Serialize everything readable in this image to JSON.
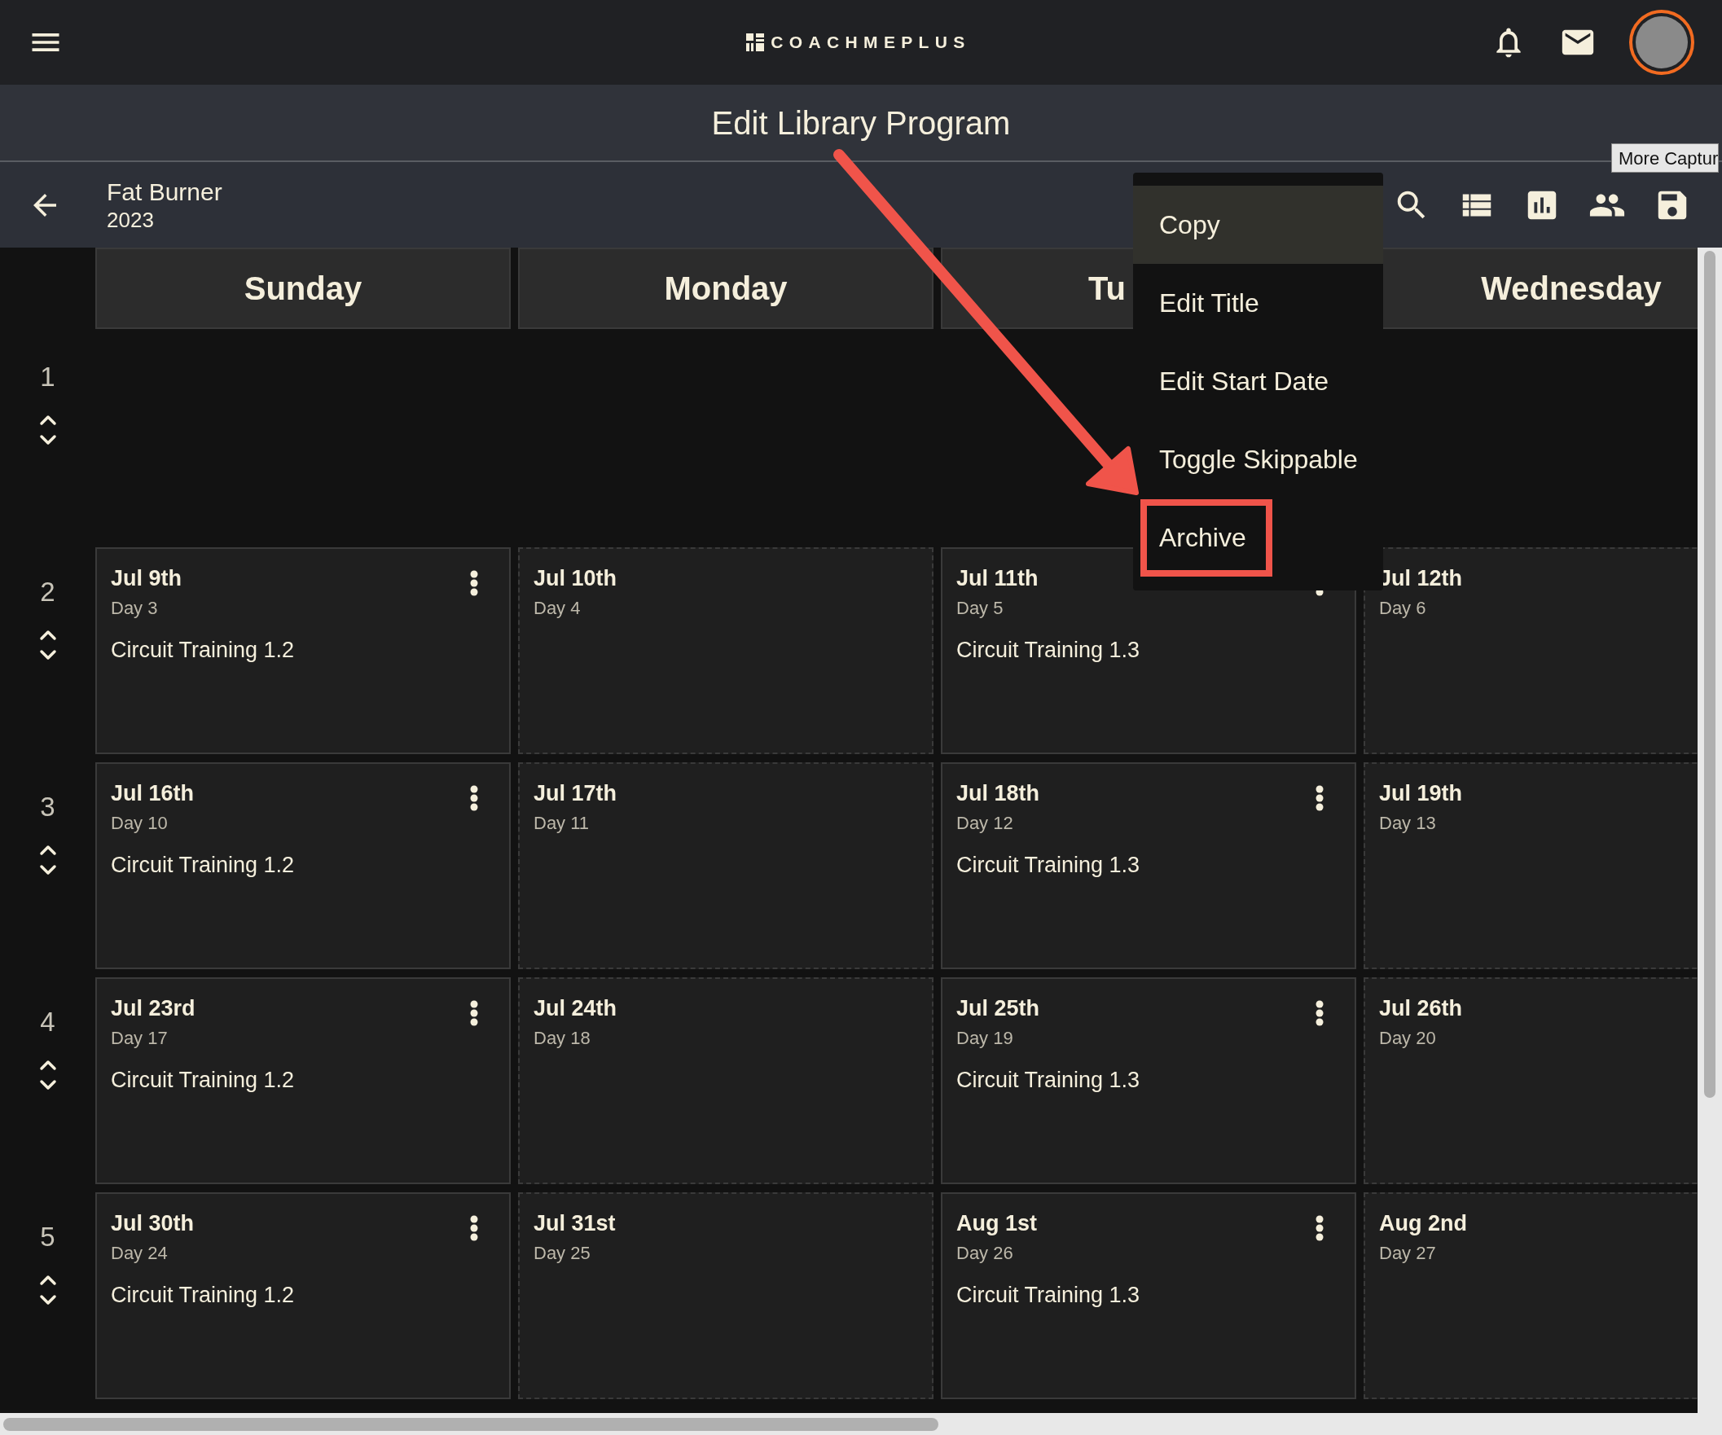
{
  "app_bar": {
    "logo": "COACHMEPLUS",
    "page_title": "Edit Library Program"
  },
  "program": {
    "name": "Fat Burner",
    "year": "2023"
  },
  "tooltip": "More Captur",
  "columns": [
    {
      "label": "Sunday",
      "kind": "full"
    },
    {
      "label": "Monday",
      "kind": "full"
    },
    {
      "label": "Tu",
      "kind": "cut"
    },
    {
      "label": "Wednesday",
      "kind": "full"
    }
  ],
  "weeks": [
    {
      "number": "1"
    },
    {
      "number": "2",
      "days": [
        {
          "kind": "workout",
          "date": "Jul 9th",
          "day": "Day 3",
          "workout": "Circuit Training 1.2"
        },
        {
          "kind": "empty",
          "date": "Jul 10th",
          "day": "Day 4"
        },
        {
          "kind": "workout",
          "date": "Jul 11th",
          "day": "Day 5",
          "workout": "Circuit Training 1.3"
        },
        {
          "kind": "empty",
          "date": "Jul 12th",
          "day": "Day 6"
        }
      ]
    },
    {
      "number": "3",
      "days": [
        {
          "kind": "workout",
          "date": "Jul 16th",
          "day": "Day 10",
          "workout": "Circuit Training 1.2"
        },
        {
          "kind": "empty",
          "date": "Jul 17th",
          "day": "Day 11"
        },
        {
          "kind": "workout",
          "date": "Jul 18th",
          "day": "Day 12",
          "workout": "Circuit Training 1.3"
        },
        {
          "kind": "empty",
          "date": "Jul 19th",
          "day": "Day 13"
        }
      ]
    },
    {
      "number": "4",
      "days": [
        {
          "kind": "workout",
          "date": "Jul 23rd",
          "day": "Day 17",
          "workout": "Circuit Training 1.2"
        },
        {
          "kind": "empty",
          "date": "Jul 24th",
          "day": "Day 18"
        },
        {
          "kind": "workout",
          "date": "Jul 25th",
          "day": "Day 19",
          "workout": "Circuit Training 1.3"
        },
        {
          "kind": "empty",
          "date": "Jul 26th",
          "day": "Day 20"
        }
      ]
    },
    {
      "number": "5",
      "days": [
        {
          "kind": "workout",
          "date": "Jul 30th",
          "day": "Day 24",
          "workout": "Circuit Training 1.2"
        },
        {
          "kind": "empty",
          "date": "Jul 31st",
          "day": "Day 25"
        },
        {
          "kind": "workout",
          "date": "Aug 1st",
          "day": "Day 26",
          "workout": "Circuit Training 1.3"
        },
        {
          "kind": "empty",
          "date": "Aug 2nd",
          "day": "Day 27"
        }
      ]
    }
  ],
  "menu": {
    "items": [
      {
        "label": "Copy",
        "selected": true,
        "highlighted": false
      },
      {
        "label": "Edit Title",
        "selected": false,
        "highlighted": false
      },
      {
        "label": "Edit Start Date",
        "selected": false,
        "highlighted": false
      },
      {
        "label": "Toggle Skippable",
        "selected": false,
        "highlighted": false
      },
      {
        "label": "Archive",
        "selected": false,
        "highlighted": true
      }
    ]
  }
}
